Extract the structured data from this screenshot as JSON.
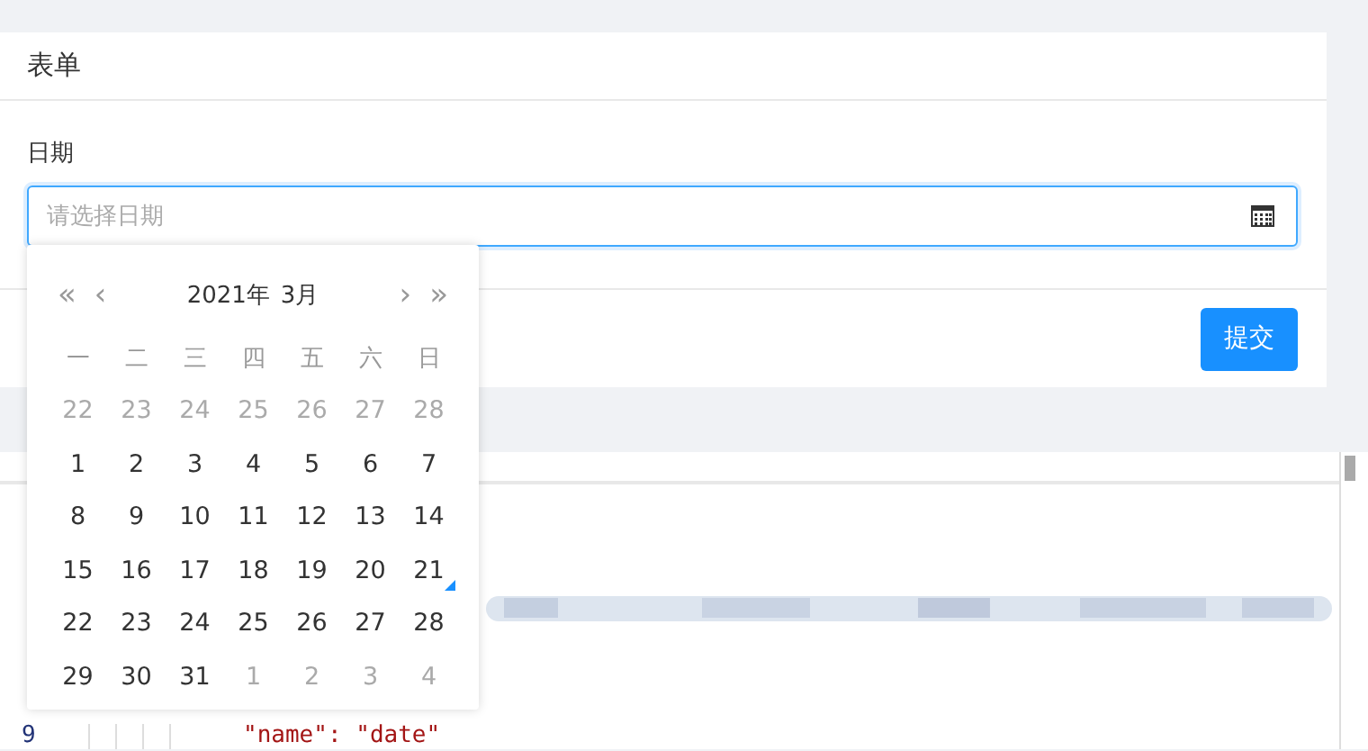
{
  "card": {
    "title": "表单",
    "field": {
      "label": "日期",
      "placeholder": "请选择日期"
    },
    "submit": "提交"
  },
  "date_picker": {
    "nav": {
      "prev_year": "«",
      "prev_month": "‹",
      "next_month": "›",
      "next_year": "»"
    },
    "year": "2021年",
    "month": "3月",
    "weekdays": [
      "一",
      "二",
      "三",
      "四",
      "五",
      "六",
      "日"
    ],
    "days": [
      {
        "label": "22",
        "outside": true,
        "today": false
      },
      {
        "label": "23",
        "outside": true,
        "today": false
      },
      {
        "label": "24",
        "outside": true,
        "today": false
      },
      {
        "label": "25",
        "outside": true,
        "today": false
      },
      {
        "label": "26",
        "outside": true,
        "today": false
      },
      {
        "label": "27",
        "outside": true,
        "today": false
      },
      {
        "label": "28",
        "outside": true,
        "today": false
      },
      {
        "label": "1",
        "outside": false,
        "today": false
      },
      {
        "label": "2",
        "outside": false,
        "today": false
      },
      {
        "label": "3",
        "outside": false,
        "today": false
      },
      {
        "label": "4",
        "outside": false,
        "today": false
      },
      {
        "label": "5",
        "outside": false,
        "today": false
      },
      {
        "label": "6",
        "outside": false,
        "today": false
      },
      {
        "label": "7",
        "outside": false,
        "today": false
      },
      {
        "label": "8",
        "outside": false,
        "today": false
      },
      {
        "label": "9",
        "outside": false,
        "today": false
      },
      {
        "label": "10",
        "outside": false,
        "today": false
      },
      {
        "label": "11",
        "outside": false,
        "today": false
      },
      {
        "label": "12",
        "outside": false,
        "today": false
      },
      {
        "label": "13",
        "outside": false,
        "today": false
      },
      {
        "label": "14",
        "outside": false,
        "today": false
      },
      {
        "label": "15",
        "outside": false,
        "today": false
      },
      {
        "label": "16",
        "outside": false,
        "today": false
      },
      {
        "label": "17",
        "outside": false,
        "today": false
      },
      {
        "label": "18",
        "outside": false,
        "today": false
      },
      {
        "label": "19",
        "outside": false,
        "today": false
      },
      {
        "label": "20",
        "outside": false,
        "today": false
      },
      {
        "label": "21",
        "outside": false,
        "today": true
      },
      {
        "label": "22",
        "outside": false,
        "today": false
      },
      {
        "label": "23",
        "outside": false,
        "today": false
      },
      {
        "label": "24",
        "outside": false,
        "today": false
      },
      {
        "label": "25",
        "outside": false,
        "today": false
      },
      {
        "label": "26",
        "outside": false,
        "today": false
      },
      {
        "label": "27",
        "outside": false,
        "today": false
      },
      {
        "label": "28",
        "outside": false,
        "today": false
      },
      {
        "label": "29",
        "outside": false,
        "today": false
      },
      {
        "label": "30",
        "outside": false,
        "today": false
      },
      {
        "label": "31",
        "outside": false,
        "today": false
      },
      {
        "label": "1",
        "outside": true,
        "today": false
      },
      {
        "label": "2",
        "outside": true,
        "today": false
      },
      {
        "label": "3",
        "outside": true,
        "today": false
      },
      {
        "label": "4",
        "outside": true,
        "today": false
      }
    ]
  },
  "code_editor": {
    "lines": [
      {
        "number": "9",
        "code": "\"name\": \"date\""
      }
    ]
  }
}
